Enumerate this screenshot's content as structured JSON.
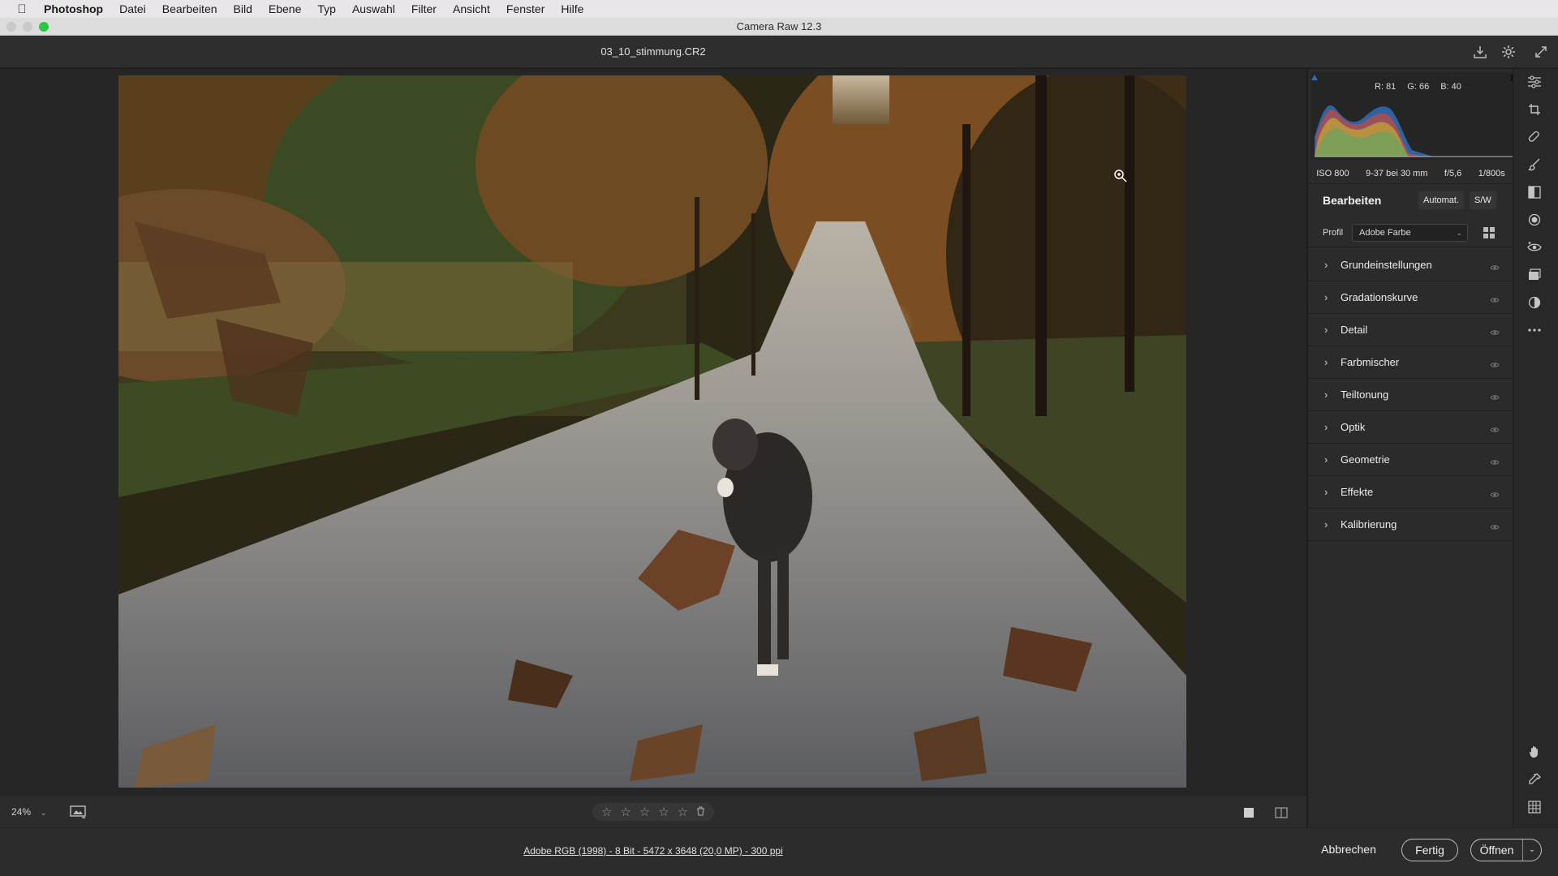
{
  "menubar": {
    "apple_icon": "apple-icon",
    "app": "Photoshop",
    "items": [
      "Datei",
      "Bearbeiten",
      "Bild",
      "Ebene",
      "Typ",
      "Auswahl",
      "Filter",
      "Ansicht",
      "Fenster",
      "Hilfe"
    ]
  },
  "window": {
    "title": "Camera Raw 12.3"
  },
  "file": {
    "name": "03_10_stimmung.CR2"
  },
  "histogram": {
    "r": "R: 81",
    "g": "G: 66",
    "b": "B: 40"
  },
  "exif": {
    "iso": "ISO 800",
    "lens": "9-37 bei 30 mm",
    "aperture": "f/5,6",
    "shutter": "1/800s"
  },
  "edit": {
    "heading": "Bearbeiten",
    "auto_label": "Automat.",
    "bw_label": "S/W",
    "profile_label": "Profil",
    "profile_value": "Adobe Farbe"
  },
  "sections": [
    {
      "name": "Grundeinstellungen"
    },
    {
      "name": "Gradationskurve"
    },
    {
      "name": "Detail"
    },
    {
      "name": "Farbmischer"
    },
    {
      "name": "Teiltonung"
    },
    {
      "name": "Optik"
    },
    {
      "name": "Geometrie"
    },
    {
      "name": "Effekte"
    },
    {
      "name": "Kalibrierung"
    }
  ],
  "bottom": {
    "zoom": "24%"
  },
  "rating": {
    "stars_total": 5,
    "stars_filled": 0
  },
  "status": {
    "info": "Adobe RGB (1998) - 8 Bit - 5472 x 3648 (20,0 MP) - 300 ppi"
  },
  "actions": {
    "cancel": "Abbrechen",
    "done": "Fertig",
    "open": "Öffnen"
  },
  "colors": {
    "accent_traffic_green": "#2ac840",
    "panel_bg": "#2b2b2b"
  }
}
